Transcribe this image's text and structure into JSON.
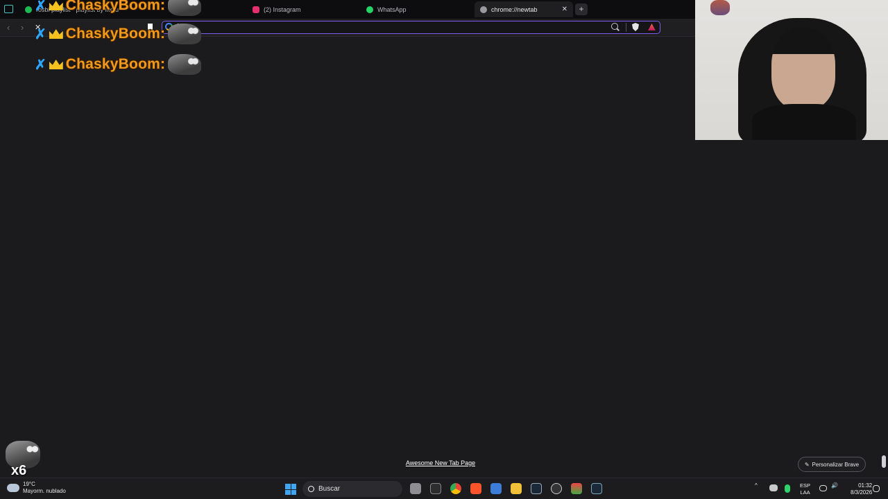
{
  "browser": {
    "tabs": [
      {
        "label": "rosbi playlist - playlist by Iketu",
        "favicon_color": "#1db954"
      },
      {
        "label": "(2) Instagram",
        "favicon_color": "#e1306c"
      },
      {
        "label": "WhatsApp",
        "favicon_color": "#25d366"
      },
      {
        "label": "chrome://newtab",
        "favicon_color": "#9a9aa0",
        "active": true
      }
    ],
    "new_tab_symbol": "+",
    "close_symbol": "✕",
    "back_symbol": "‹",
    "forward_symbol": "›",
    "stop_symbol": "✕",
    "omnibox_value": "",
    "accent_color": "#7a5cf0"
  },
  "overlay": {
    "chat_lines": [
      {
        "name": "ChaskyBoom:"
      },
      {
        "name": "ChaskyBoom:"
      },
      {
        "name": "ChaskyBoom:"
      }
    ],
    "emote_counter": "x6"
  },
  "newtab": {
    "footer_link": "Awesome New Tab Page",
    "customize_button": "Personalizar Brave"
  },
  "taskbar": {
    "weather_temp": "19°C",
    "weather_desc": "Mayorm. nublado",
    "search_label": "Buscar",
    "lang_top": "ESP",
    "lang_bottom": "LAA",
    "time": "01:32",
    "date": "8/3/2026"
  }
}
